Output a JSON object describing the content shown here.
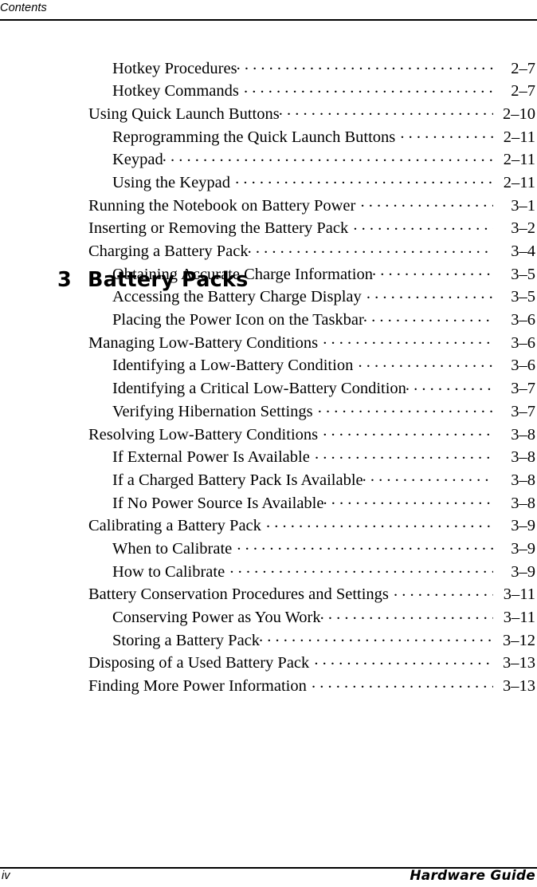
{
  "header": {
    "running_head": "Contents"
  },
  "toc_before_chapter": [
    {
      "level": 1,
      "title": "Hotkey Procedures",
      "page": "2–7",
      "tight": true
    },
    {
      "level": 1,
      "title": "Hotkey Commands",
      "page": "2–7",
      "tight": false
    },
    {
      "level": 0,
      "title": "Using Quick Launch Buttons",
      "page": "2–10",
      "tight": true
    },
    {
      "level": 1,
      "title": "Reprogramming the Quick Launch Buttons",
      "page": "2–11",
      "tight": false
    },
    {
      "level": 1,
      "title": "Keypad",
      "page": "2–11",
      "tight": true
    },
    {
      "level": 1,
      "title": "Using the Keypad",
      "page": "2–11",
      "tight": false
    }
  ],
  "chapter": {
    "number": "3",
    "title": "Battery Packs"
  },
  "toc_chapter_entries": [
    {
      "level": 0,
      "title": "Running the Notebook on Battery Power",
      "page": "3–1",
      "tight": false
    },
    {
      "level": 0,
      "title": "Inserting or Removing the Battery Pack",
      "page": "3–2",
      "tight": false
    },
    {
      "level": 0,
      "title": "Charging a Battery Pack",
      "page": "3–4",
      "tight": true
    },
    {
      "level": 1,
      "title": "Obtaining Accurate Charge Information",
      "page": "3–5",
      "tight": true
    },
    {
      "level": 1,
      "title": "Accessing the Battery Charge Display",
      "page": "3–5",
      "tight": false
    },
    {
      "level": 1,
      "title": "Placing the Power Icon on the Taskbar",
      "page": "3–6",
      "tight": true
    },
    {
      "level": 0,
      "title": "Managing Low-Battery Conditions",
      "page": "3–6",
      "tight": false
    },
    {
      "level": 1,
      "title": "Identifying a Low-Battery Condition",
      "page": "3–6",
      "tight": false
    },
    {
      "level": 1,
      "title": "Identifying a Critical Low-Battery Condition",
      "page": "3–7",
      "tight": true
    },
    {
      "level": 1,
      "title": "Verifying Hibernation Settings",
      "page": "3–7",
      "tight": false
    },
    {
      "level": 0,
      "title": "Resolving Low-Battery Conditions",
      "page": "3–8",
      "tight": false
    },
    {
      "level": 1,
      "title": "If External Power Is Available",
      "page": "3–8",
      "tight": false
    },
    {
      "level": 1,
      "title": "If a Charged Battery Pack Is Available",
      "page": "3–8",
      "tight": true
    },
    {
      "level": 1,
      "title": "If No Power Source Is Available",
      "page": "3–8",
      "tight": true
    },
    {
      "level": 0,
      "title": "Calibrating a Battery Pack",
      "page": "3–9",
      "tight": false
    },
    {
      "level": 1,
      "title": "When to Calibrate",
      "page": "3–9",
      "tight": false
    },
    {
      "level": 1,
      "title": "How to Calibrate",
      "page": "3–9",
      "tight": false
    },
    {
      "level": 0,
      "title": "Battery Conservation Procedures and Settings",
      "page": "3–11",
      "tight": false
    },
    {
      "level": 1,
      "title": "Conserving Power as You Work",
      "page": "3–11",
      "tight": true
    },
    {
      "level": 1,
      "title": "Storing a Battery Pack",
      "page": "3–12",
      "tight": true
    },
    {
      "level": 0,
      "title": "Disposing of a Used Battery Pack",
      "page": "3–13",
      "tight": false
    },
    {
      "level": 0,
      "title": "Finding More Power Information",
      "page": "3–13",
      "tight": false
    }
  ],
  "footer": {
    "folio": "iv",
    "guide_name": "Hardware Guide"
  }
}
